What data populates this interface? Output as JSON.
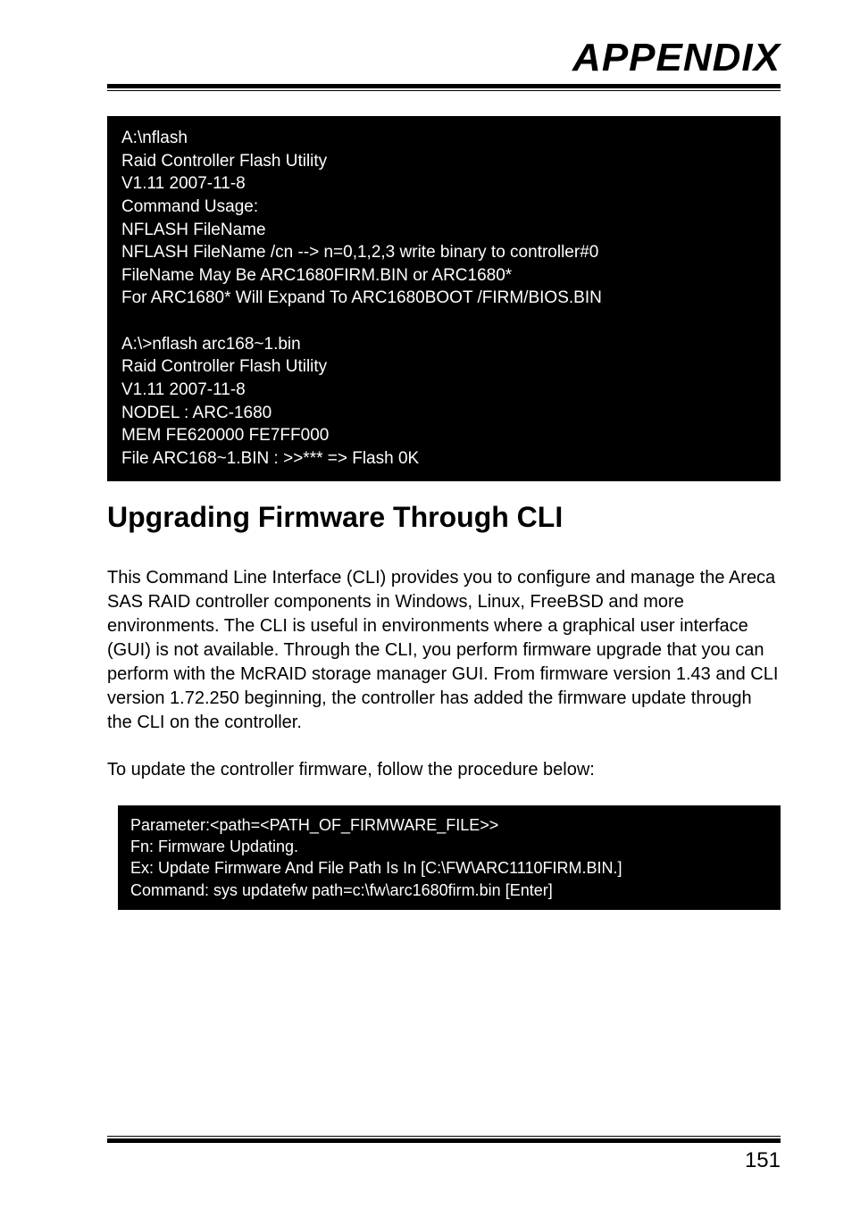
{
  "header": {
    "title": "APPENDIX"
  },
  "code_block_1": "A:\\nflash\nRaid Controller Flash Utility\nV1.11 2007-11-8\nCommand Usage:\nNFLASH FileName\nNFLASH FileName /cn --> n=0,1,2,3 write binary to controller#0\nFileName May Be ARC1680FIRM.BIN or ARC1680*\nFor ARC1680* Will Expand To ARC1680BOOT /FIRM/BIOS.BIN\n\nA:\\>nflash arc168~1.bin\nRaid Controller Flash Utility\nV1.11 2007-11-8\nNODEL : ARC-1680\nMEM FE620000 FE7FF000\nFile ARC168~1.BIN : >>*** => Flash 0K",
  "section": {
    "heading": "Upgrading Firmware Through CLI",
    "paragraph_1": "This Command Line Interface (CLI) provides you to configure and manage the Areca SAS RAID controller components in Windows, Linux, FreeBSD and more environments. The CLI is useful in environments where a graphical user interface (GUI) is not available. Through the CLI, you perform firmware upgrade that you can perform with the McRAID storage manager GUI. From firmware version 1.43 and CLI version 1.72.250 beginning, the controller has added the firmware update through the CLI on the controller.",
    "paragraph_2": "To update the controller firmware, follow the procedure below:"
  },
  "code_block_2": "Parameter:<path=<PATH_OF_FIRMWARE_FILE>>\nFn: Firmware Updating.\nEx: Update Firmware And File Path Is In [C:\\FW\\ARC1110FIRM.BIN.]\nCommand: sys updatefw path=c:\\fw\\arc1680firm.bin [Enter]",
  "footer": {
    "page_number": "151"
  }
}
